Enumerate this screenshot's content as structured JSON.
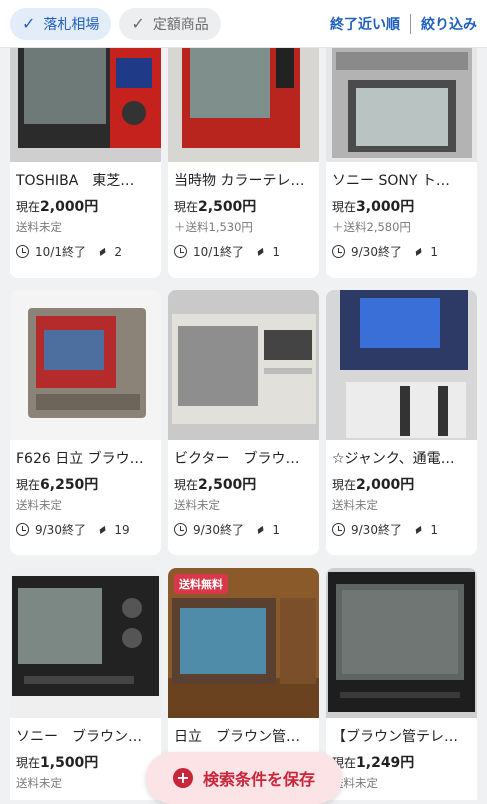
{
  "filters": {
    "chip_market": "落札相場",
    "chip_fixed": "定額商品",
    "sort": "終了近い順",
    "refine": "絞り込み"
  },
  "items": [
    {
      "title": "TOSHIBA　東芝…",
      "price_prefix": "現在",
      "price": "2,000円",
      "shipping": "送料未定",
      "end": "10/1終了",
      "bids": "2"
    },
    {
      "title": "当時物 カラーテレ…",
      "price_prefix": "現在",
      "price": "2,500円",
      "shipping": "＋送料1,530円",
      "end": "10/1終了",
      "bids": "1"
    },
    {
      "title": "ソニー SONY ト…",
      "price_prefix": "現在",
      "price": "3,000円",
      "shipping": "＋送料2,580円",
      "end": "9/30終了",
      "bids": "1"
    },
    {
      "title": "F626 日立 ブラウ…",
      "price_prefix": "現在",
      "price": "6,250円",
      "shipping": "送料未定",
      "end": "9/30終了",
      "bids": "19"
    },
    {
      "title": "ビクター　ブラウ…",
      "price_prefix": "現在",
      "price": "2,500円",
      "shipping": "送料未定",
      "end": "9/30終了",
      "bids": "1"
    },
    {
      "title": "☆ジャンク、通電…",
      "price_prefix": "現在",
      "price": "2,000円",
      "shipping": "送料未定",
      "end": "9/30終了",
      "bids": "1"
    },
    {
      "title": "ソニー　ブラウン…",
      "price_prefix": "現在",
      "price": "1,500円",
      "shipping": "送料未定",
      "badge": ""
    },
    {
      "title": "日立　ブラウン管…",
      "price_prefix": "現在",
      "price": "",
      "shipping": "",
      "badge": "送料無料"
    },
    {
      "title": "【ブラウン管テレ…",
      "price_prefix": "現在",
      "price": "1,249円",
      "shipping": "送料未定",
      "badge": ""
    }
  ],
  "save_search": "検索条件を保存"
}
